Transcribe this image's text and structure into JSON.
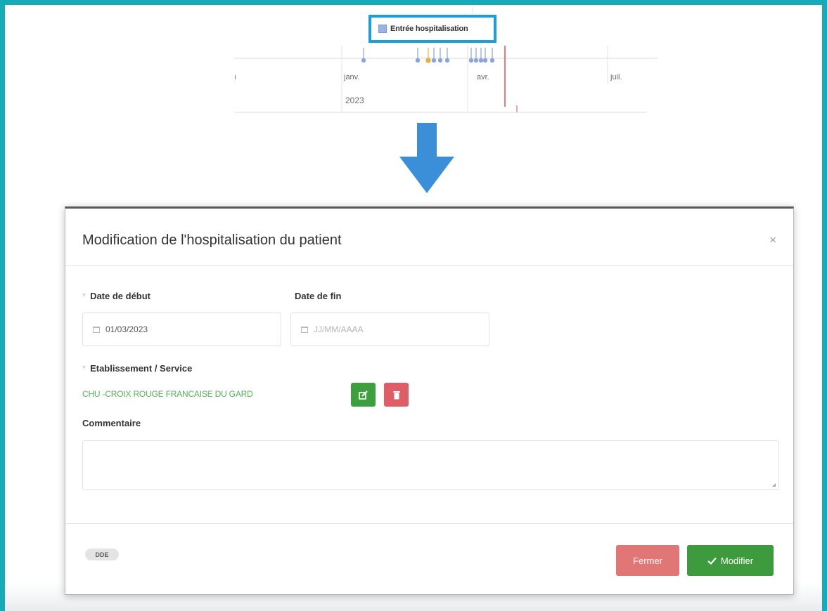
{
  "timeline": {
    "legend_label": "Entrée hospitalisation",
    "ticks": [
      "janv.",
      "avr.",
      "juil."
    ],
    "year": "2023"
  },
  "modal": {
    "title": "Modification de l'hospitalisation du patient",
    "close_glyph": "×",
    "date_start": {
      "label": "Date de début",
      "required_mark": "*",
      "value": "01/03/2023"
    },
    "date_end": {
      "label": "Date de fin",
      "placeholder": "JJ/MM/AAAA"
    },
    "establishment": {
      "label": "Etablissement / Service",
      "required_mark": "*",
      "value": "CHU -CROIX ROUGE FRANCAISE DU GARD"
    },
    "comment": {
      "label": "Commentaire",
      "value": ""
    },
    "badge": "DDE",
    "buttons": {
      "close": "Fermer",
      "save": "Modifier"
    }
  },
  "colors": {
    "frame": "#17aab8",
    "highlight": "#1aa0d8",
    "success": "#3d9a3d",
    "danger": "#de5d66",
    "arrow": "#3a8fd8"
  },
  "icons": {
    "calendar": "calendar-icon",
    "edit": "edit-icon",
    "delete": "trash-icon",
    "check": "check-icon",
    "arrow": "arrow-down-icon"
  }
}
